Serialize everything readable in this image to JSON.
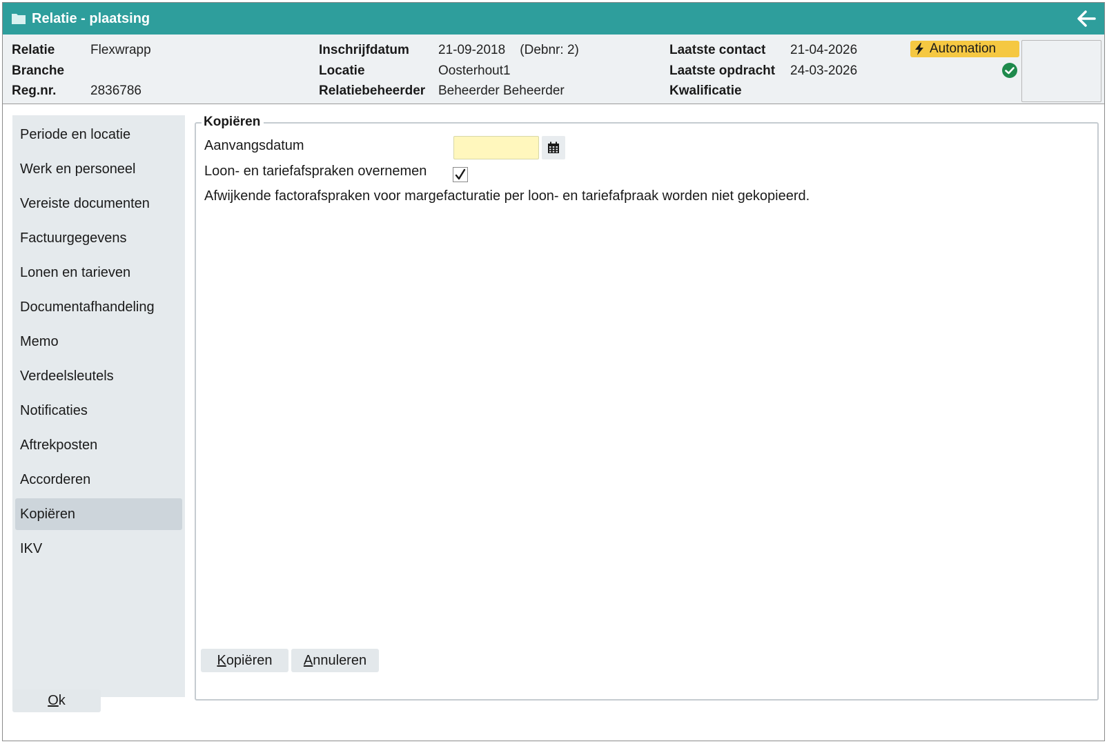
{
  "window": {
    "title": "Relatie - plaatsing"
  },
  "header": {
    "col1": [
      {
        "label": "Relatie",
        "value": "Flexwrapp"
      },
      {
        "label": "Branche",
        "value": ""
      },
      {
        "label": "Reg.nr.",
        "value": "2836786"
      }
    ],
    "col2": [
      {
        "label": "Inschrijfdatum",
        "value": "21-09-2018    (Debnr: 2)"
      },
      {
        "label": "Locatie",
        "value": "Oosterhout1"
      },
      {
        "label": "Relatiebeheerder",
        "value": "Beheerder Beheerder"
      }
    ],
    "col3": [
      {
        "label": "Laatste contact",
        "value": "21-04-2026"
      },
      {
        "label": "Laatste opdracht",
        "value": "24-03-2026"
      },
      {
        "label": "Kwalificatie",
        "value": ""
      }
    ],
    "automation_label": "Automation",
    "colors": {
      "titlebar": "#2e9e9c",
      "automation": "#f5c842",
      "status_ok": "#1e8a4c"
    }
  },
  "sidebar": {
    "items": [
      {
        "label": "Periode en locatie"
      },
      {
        "label": "Werk en personeel"
      },
      {
        "label": "Vereiste documenten"
      },
      {
        "label": "Factuurgegevens"
      },
      {
        "label": "Lonen en tarieven"
      },
      {
        "label": "Documentafhandeling"
      },
      {
        "label": "Memo"
      },
      {
        "label": "Verdeelsleutels"
      },
      {
        "label": "Notificaties"
      },
      {
        "label": "Aftrekposten"
      },
      {
        "label": "Accorderen"
      },
      {
        "label": "Kopiëren",
        "active": true
      },
      {
        "label": "IKV"
      }
    ]
  },
  "form": {
    "legend": "Kopiëren",
    "start_date_label": "Aanvangsdatum",
    "start_date_value": "",
    "copy_rates_label": "Loon- en tariefafspraken overnemen",
    "copy_rates_checked": true,
    "note": "Afwijkende factorafspraken voor margefacturatie per loon- en tariefafpraak worden niet gekopieerd.",
    "copy_button": {
      "mnemonic": "K",
      "rest": "opiëren"
    },
    "cancel_button": {
      "mnemonic": "A",
      "rest": "nnuleren"
    }
  },
  "footer": {
    "ok_button": {
      "mnemonic": "O",
      "rest": "k"
    }
  }
}
